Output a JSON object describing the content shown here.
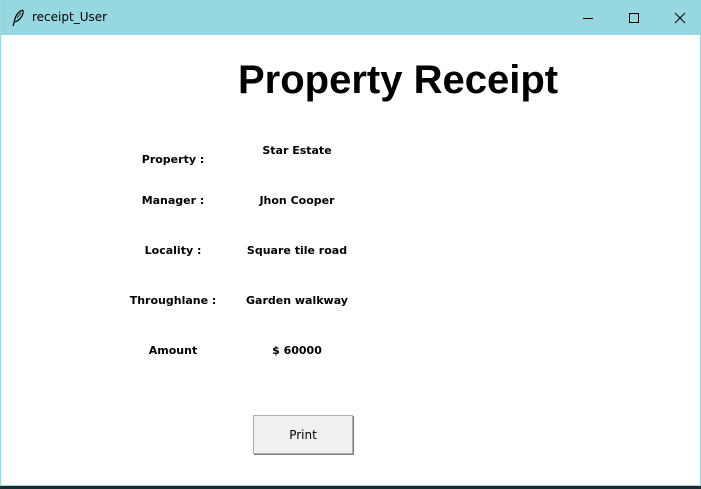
{
  "window": {
    "title": "receipt_User",
    "controls": [
      "minimize",
      "maximize",
      "close"
    ]
  },
  "heading": "Property Receipt",
  "fields": [
    {
      "label": "Property :",
      "value": "Star Estate"
    },
    {
      "label": "Manager :",
      "value": "Jhon Cooper"
    },
    {
      "label": "Locality :",
      "value": "Square tile road"
    },
    {
      "label": "Throughlane :",
      "value": "Garden walkway"
    },
    {
      "label": "Amount",
      "value": "$ 60000"
    }
  ],
  "print_button": "Print",
  "colors": {
    "titlebar": "#97d7e0",
    "background": "#ffffff",
    "button": "#f0f0f0"
  },
  "icons": {
    "app": "feather-icon",
    "minimize": "minimize-icon",
    "maximize": "maximize-icon",
    "close": "close-icon"
  }
}
